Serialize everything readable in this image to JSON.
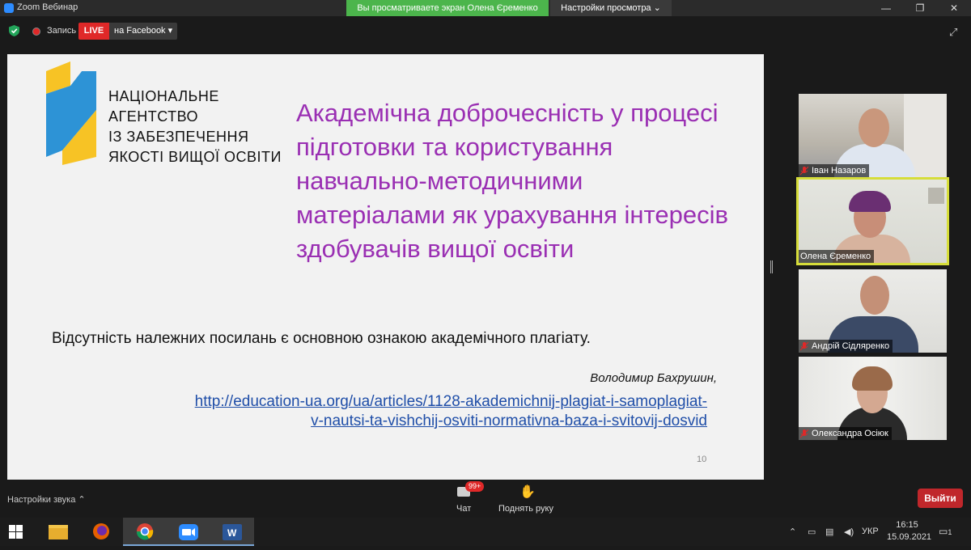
{
  "window": {
    "title": "Zoom Вебинар"
  },
  "share_banner": {
    "text": "Вы просматриваете экран Олена Єременко",
    "view_options": "Настройки просмотра ⌄"
  },
  "recording": {
    "label": "Запись"
  },
  "live": {
    "badge": "LIVE",
    "target": "на Facebook ▾"
  },
  "slide": {
    "agency_lines": [
      "НАЦІОНАЛЬНЕ",
      "АГЕНТСТВО",
      "ІЗ ЗАБЕЗПЕЧЕННЯ",
      "ЯКОСТІ ВИЩОЇ ОСВІТИ"
    ],
    "title": "Академічна доброчесність у процесі підготовки та користування навчально-методичними матеріалами як урахування інтересів здобувачів вищої освіти",
    "quote": "Відсутність належних посилань є основною ознакою академічного плагіату.",
    "author": "Володимир Бахрушин,",
    "link_line1": "http://education-ua.org/ua/articles/1128-akademichnij-plagiat-i-samoplagiat-",
    "link_line2": "v-nautsi-ta-vishchij-osviti-normativna-baza-i-svitovij-dosvid",
    "page_number": "10"
  },
  "participants": [
    {
      "name": "Іван Назаров",
      "active": false
    },
    {
      "name": "Олена Єременко",
      "active": true
    },
    {
      "name": "Андрій Сідляренко",
      "active": false
    },
    {
      "name": "Олександра Осіюк",
      "active": false
    }
  ],
  "bottom": {
    "audio_settings": "Настройки звука ⌃",
    "chat_badge": "99+",
    "chat_label": "Чат",
    "raise_hand_label": "Поднять руку",
    "leave_label": "Выйти"
  },
  "taskbar": {
    "language": "УКР",
    "time": "16:15",
    "date": "15.09.2021",
    "notifications_count": "1"
  },
  "colors": {
    "live_red": "#e02828",
    "banner_green": "#4cb54c",
    "title_purple": "#9a2fb3",
    "link_blue": "#1f4ea8",
    "active_speaker": "#d6dd3a"
  }
}
